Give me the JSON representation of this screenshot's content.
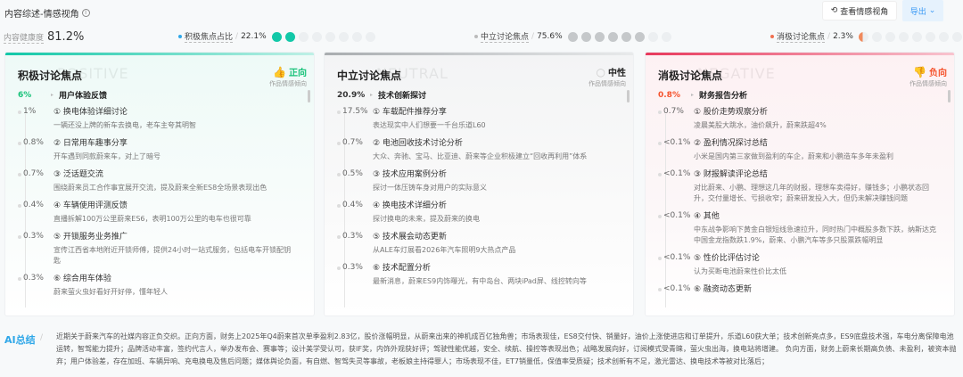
{
  "header": {
    "title": "内容综述-情感视角",
    "view_button": "查看情感视角",
    "export_button": "导出"
  },
  "health": {
    "label": "内容健康度",
    "value": "81.2%"
  },
  "stats": [
    {
      "label": "积极焦点占比",
      "value": "22.1%",
      "color": "#12c8a8",
      "filled": 2,
      "total": 8
    },
    {
      "label": "中立讨论焦点",
      "value": "75.6%",
      "color": "#c5c8ca",
      "filled": 6,
      "total": 8
    },
    {
      "label": "消极讨论焦点",
      "value": "2.3%",
      "color": "#f08a5d",
      "filled": 0.2,
      "total": 8
    }
  ],
  "cards": [
    {
      "title": "积极讨论焦点",
      "watermark": "POSITIVE",
      "tone": "正向",
      "tone_sub": "作品情感倾向",
      "main_pct": "6%",
      "main_label": "用户体验反馈",
      "items": [
        {
          "pct": "1%",
          "title": "① 换电体验详细讨论",
          "desc": "一辆还没上牌的新车去换电，老车主夸其明智"
        },
        {
          "pct": "0.8%",
          "title": "② 日常用车趣事分享",
          "desc": "开车遇到同款蔚来车，对上了暗号"
        },
        {
          "pct": "0.7%",
          "title": "③ 泛话题交流",
          "desc": "围绕蔚来员工合作事宜展开交流，提及蔚来全新ES8全场景表现出色"
        },
        {
          "pct": "0.4%",
          "title": "④ 车辆使用评测反馈",
          "desc": "直播拆解100万公里蔚来ES6，表明100万公里的电车也很可靠"
        },
        {
          "pct": "0.3%",
          "title": "⑤ 开锁服务业务推广",
          "desc": "宣传江西省本地附近开锁师傅，提供24小时一站式服务，包括电车开锁配钥匙"
        },
        {
          "pct": "0.3%",
          "title": "⑥ 综合用车体验",
          "desc": "蔚来萤火虫好看好开好停，懂年轻人"
        }
      ]
    },
    {
      "title": "中立讨论焦点",
      "watermark": "NEUTRAL",
      "tone": "中性",
      "tone_sub": "作品情感倾向",
      "main_pct": "20.9%",
      "main_label": "技术创新探讨",
      "items": [
        {
          "pct": "17.5%",
          "title": "① 车载配件推荐分享",
          "desc": "表达现实中人们想要一千台乐道L60"
        },
        {
          "pct": "0.7%",
          "title": "② 电池回收技术讨论分析",
          "desc": "大众、奔驰、宝马、比亚迪、蔚来等企业积极建立“回收再利用”体系"
        },
        {
          "pct": "0.5%",
          "title": "③ 技术应用案例分析",
          "desc": "探讨一体压铸车身对用户的实际意义"
        },
        {
          "pct": "0.4%",
          "title": "④ 换电技术详细分析",
          "desc": "探讨换电的未来，提及蔚来的换电"
        },
        {
          "pct": "0.3%",
          "title": "⑤ 技术展会动态更新",
          "desc": "从ALE车灯展看2026年汽车照明9大热点产品"
        },
        {
          "pct": "0.3%",
          "title": "⑥ 技术配置分析",
          "desc": "最新消息，蔚来ES9内饰曝光，有中岛台、两块iPad屏、线控转向等"
        }
      ]
    },
    {
      "title": "消极讨论焦点",
      "watermark": "NEGATIVE",
      "tone": "负向",
      "tone_sub": "作品情感倾向",
      "main_pct": "0.8%",
      "main_label": "财务报告分析",
      "items": [
        {
          "pct": "0.7%",
          "title": "① 股价走势观察分析",
          "desc": "凌晨美股大跳水，油价飙升，蔚来跌超4%"
        },
        {
          "pct": "<0.1%",
          "title": "② 盈利情况探讨总结",
          "desc": "小米是国内第三家做到盈利的车企，蔚来和小鹏造车多年未盈利"
        },
        {
          "pct": "<0.1%",
          "title": "③ 财报解读评论总结",
          "desc": "对比蔚来、小鹏、理想这几年的财报，理想车卖得好，赚钱多；小鹏状态回升，交付量增长、亏损收窄；蔚来研发投入大，但仍未解决赚钱问题"
        },
        {
          "pct": "<0.1%",
          "title": "④ 其他",
          "desc": "中东战争影响下黄金白银短线急速拉升，同时热门中概股多数下跌，纳斯达克中国金龙指数跌1.9%，蔚来、小鹏汽车等多只股票跌幅明显"
        },
        {
          "pct": "<0.1%",
          "title": "⑤ 性价比评估讨论",
          "desc": "认为买断电池蔚来性价比太低"
        },
        {
          "pct": "<0.1%",
          "title": "⑥ 融资动态更新",
          "desc": ""
        }
      ]
    }
  ],
  "ai": {
    "label": "AI总结",
    "text": "近期关于蔚来汽车的社媒内容正负交织。正向方面，财务上2025年Q4蔚来首次单季盈利2.83亿，股价涨幅明显，从蔚来出来的神机成百亿独角兽；市场表现佳，ES8交付快、销量好，油价上涨使进店和订单提升，乐道L60获大单；技术创新亮点多，ES9底盘技术强，车电分离保障电池运转，智驾能力提升；品牌活动丰富，签约代言人，举办发布会、赛事等；设计美学受认可，获IF奖，内饰外观获好评；驾驶性能优越，安全、续航、操控等表现出色；战略发展向好，订阅模式受青睐，萤火虫出海，换电站将增建。 负向方面，财务上蔚来长期高负债、未盈利，被资本抛弃；用户体验差，存在加班、车辆异响、充电换电及售后问题；媒体舆论负面，有自燃、智驾失灵等事故，老板娘主持得罪人；市场表现不佳，ET7销量低，保值率受质疑；技术创新有不足，激光雷达、换电技术等被对比落后；"
  },
  "colors": {
    "positive": "#12c8a8",
    "neutral": "#bfc3c6",
    "negative": "#ef4f6c",
    "pos_text": "#19c27a",
    "neg_text": "#f5532d",
    "accent": "#3b9af5"
  }
}
